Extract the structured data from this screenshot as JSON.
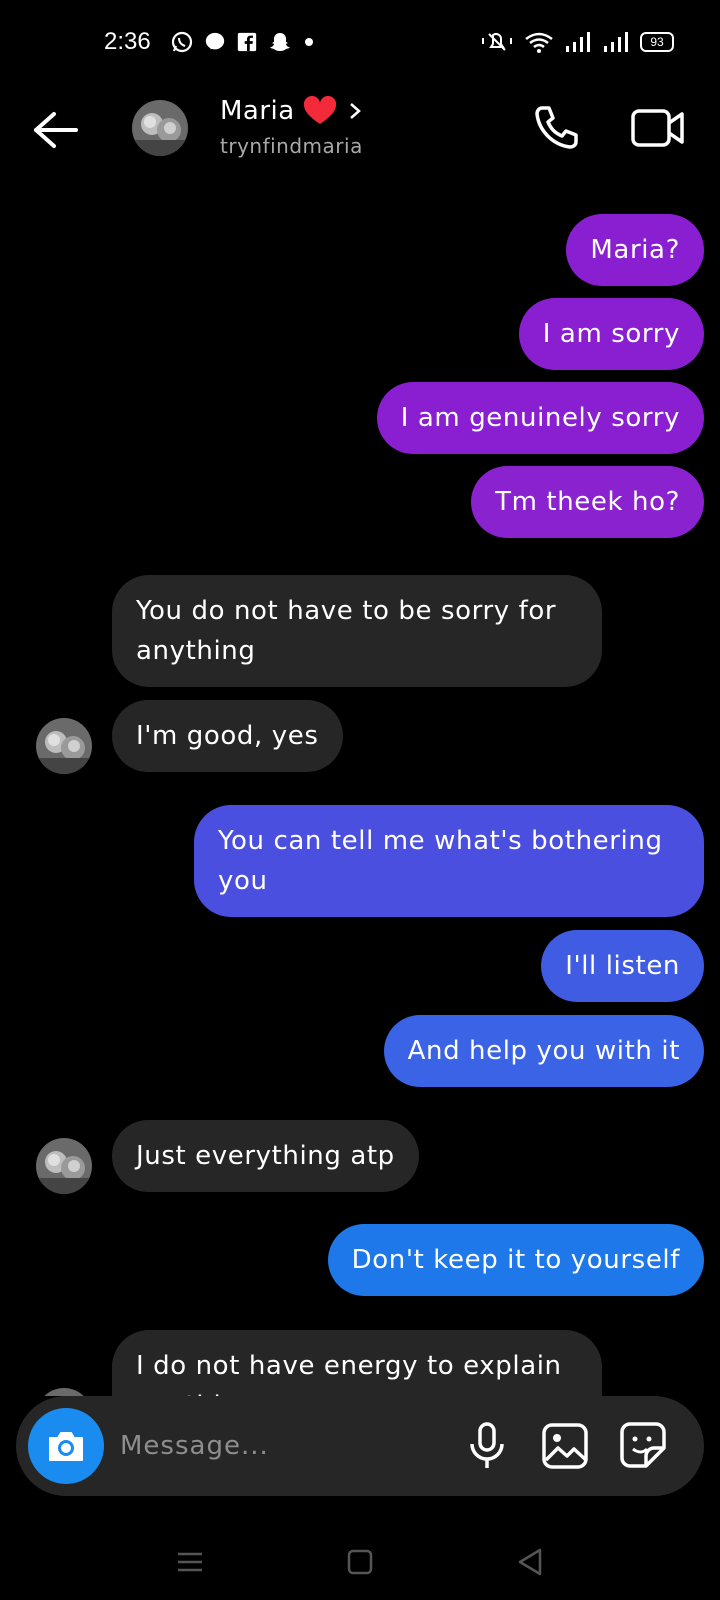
{
  "status_bar": {
    "time": "2:36",
    "battery": "93",
    "left_icons": [
      "whatsapp-icon",
      "messenger-icon",
      "facebook-icon",
      "snapchat-icon",
      "dot-icon"
    ],
    "right_icons": [
      "mute-icon",
      "wifi-icon",
      "signal-icon",
      "signal-icon"
    ]
  },
  "header": {
    "contact_name": "Maria",
    "name_emoji": "❤️",
    "handle": "trynfindmaria"
  },
  "colors": {
    "background": "#000000",
    "incoming_bubble": "#262626",
    "outgoing_purple": "#8a1fd1",
    "outgoing_indigo": "#4d4be3",
    "outgoing_blue": "#1f78ea",
    "camera_button": "#1a8cf0"
  },
  "messages": [
    {
      "direction": "out",
      "text": "Maria?"
    },
    {
      "direction": "out",
      "text": "I am sorry"
    },
    {
      "direction": "out",
      "text": "I am genuinely sorry"
    },
    {
      "direction": "out",
      "text": "Tm theek ho?"
    },
    {
      "direction": "in",
      "text": "You do not have to be sorry for anything"
    },
    {
      "direction": "in",
      "text": "I'm good, yes"
    },
    {
      "direction": "out",
      "text": "You can tell me what's bothering you"
    },
    {
      "direction": "out",
      "text": "I'll listen"
    },
    {
      "direction": "out",
      "text": "And help you with it"
    },
    {
      "direction": "in",
      "text": "Just everything atp"
    },
    {
      "direction": "out",
      "text": "Don't keep it to yourself"
    },
    {
      "direction": "in",
      "text": "I do not have energy to explain anything"
    }
  ],
  "composer": {
    "placeholder": "Message..."
  }
}
